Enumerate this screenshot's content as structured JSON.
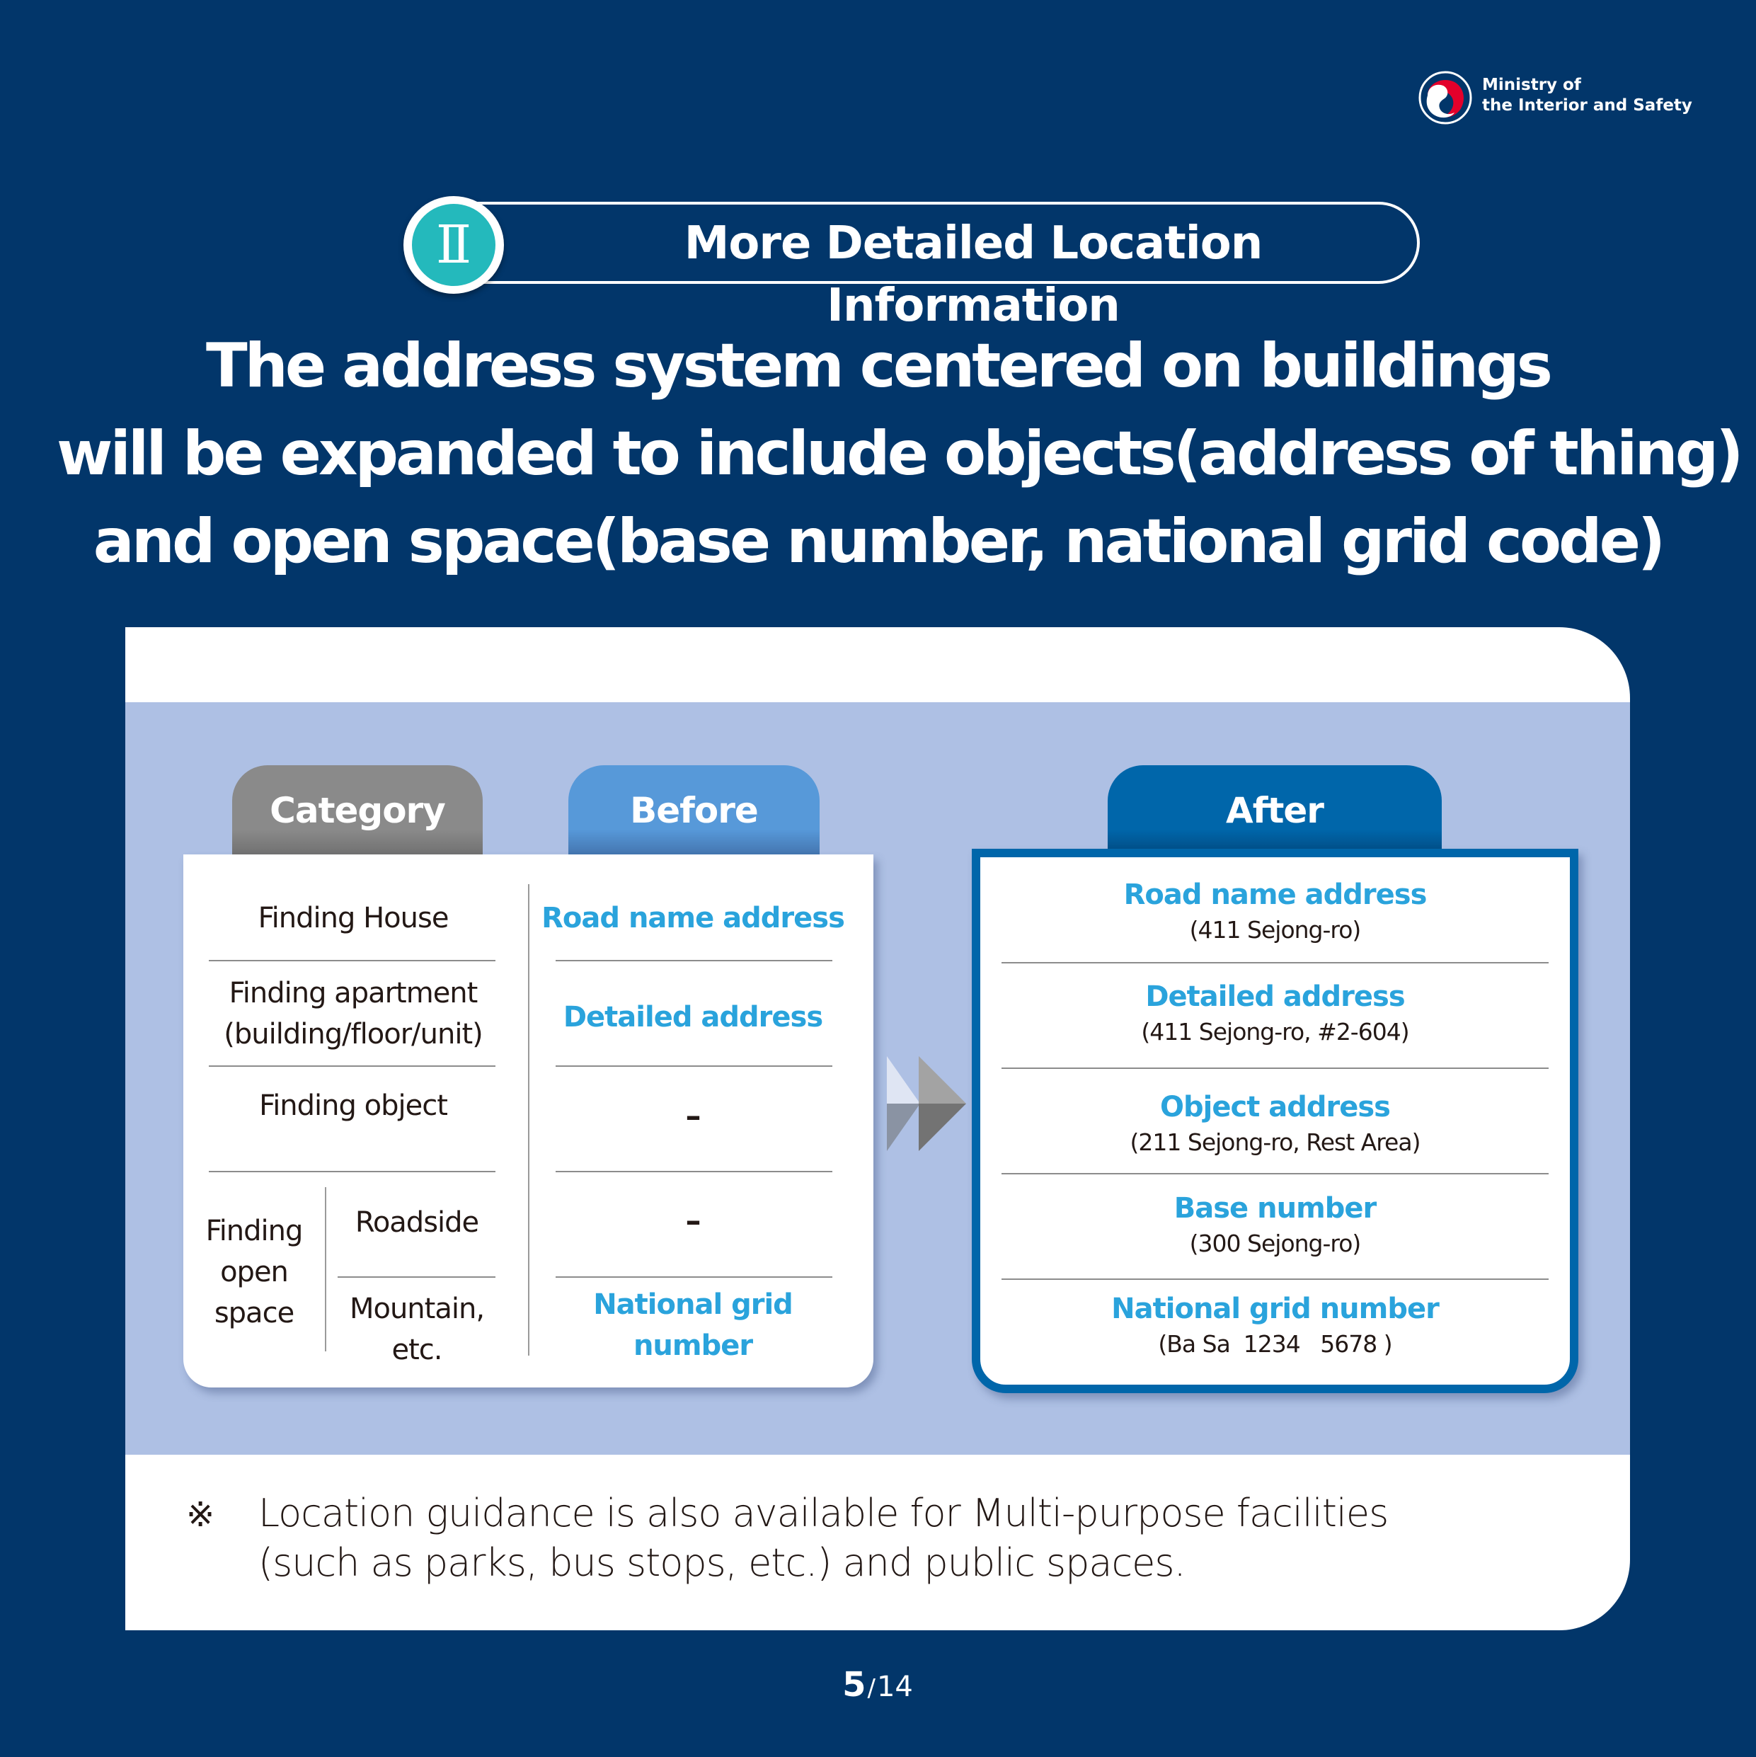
{
  "header": {
    "ministry_line1": "Ministry of",
    "ministry_line2": "the Interior and Safety",
    "emblem_icon": "taegeuk-emblem-icon"
  },
  "section": {
    "number": "Ⅱ",
    "title": "More Detailed Location Information"
  },
  "headline": {
    "lines": [
      "The address system centered on buildings",
      "will be expanded to include objects(address of thing)",
      "and open space(base number, national grid code)"
    ]
  },
  "table": {
    "headers": {
      "category": "Category",
      "before": "Before",
      "after": "After"
    },
    "categories": {
      "house": "Finding House",
      "apartment_line1": "Finding apartment",
      "apartment_line2": "(building/floor/unit)",
      "object": "Finding object",
      "open_space_line1": "Finding",
      "open_space_line2": "open",
      "open_space_line3": "space",
      "roadside": "Roadside",
      "mountain_line1": "Mountain,",
      "mountain_line2": "etc."
    },
    "before": {
      "house": "Road name address",
      "apartment": "Detailed address",
      "object": "–",
      "roadside": "–",
      "mountain": "National grid number"
    },
    "after": [
      {
        "title": "Road name address",
        "example": "(411 Sejong-ro)"
      },
      {
        "title": "Detailed address",
        "example": "(411 Sejong-ro, #2-604)"
      },
      {
        "title": "Object address",
        "example": "(211 Sejong-ro, Rest Area)"
      },
      {
        "title": "Base number",
        "example": "(300 Sejong-ro)"
      },
      {
        "title": "National grid number",
        "example": "(Ba Sa  1234   5678 )"
      }
    ],
    "arrow_icon": "double-chevron-right-icon"
  },
  "note": {
    "mark": "※",
    "line1": "Location guidance is also available for Multi-purpose facilities",
    "line2": "(such as parks, bus stops, etc.) and public spaces."
  },
  "pagination": {
    "current": "5",
    "separator": "/",
    "total": "14"
  },
  "colors": {
    "background": "#02366a",
    "band": "#aec0e4",
    "accent_teal": "#24b9bc",
    "highlight_blue": "#2aa3dc",
    "after_blue": "#0066aa",
    "before_blue": "#5799d9",
    "category_gray": "#8a8a8a"
  }
}
